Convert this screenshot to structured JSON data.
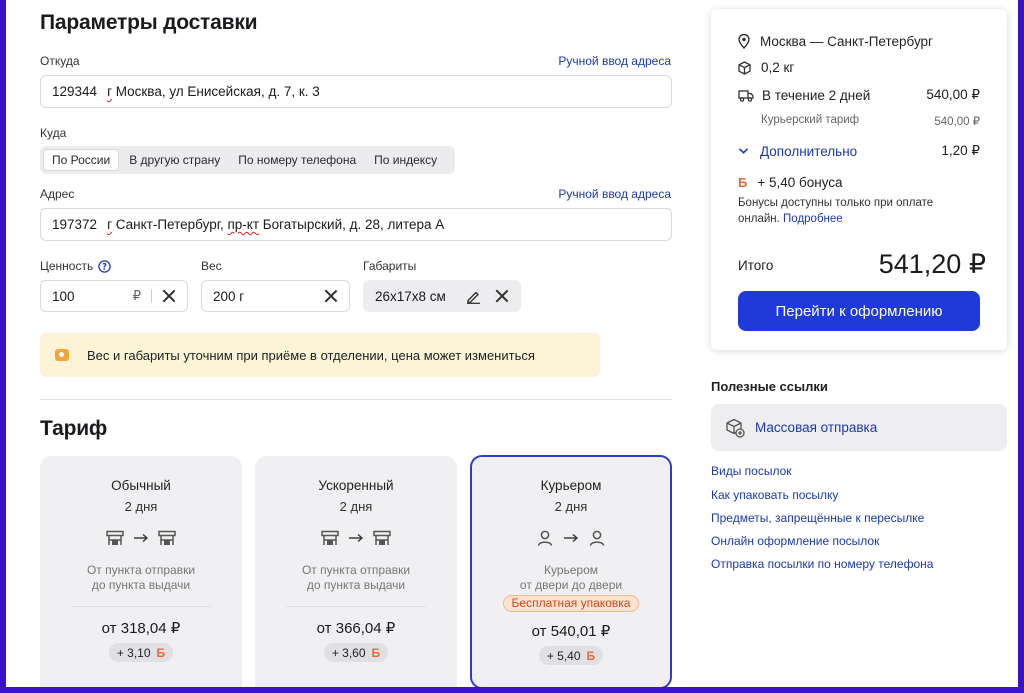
{
  "page": {
    "title": "Параметры доставки",
    "from": {
      "label": "Откуда",
      "manual_link": "Ручной ввод адреса",
      "zip": "129344",
      "w1": "г",
      "address": " Москва, ул Енисейская, ",
      "w2": "д",
      "tail": ". 7, к. 3"
    },
    "to": {
      "label": "Куда",
      "tabs": [
        "По России",
        "В другую страну",
        "По номеру телефона",
        "По индексу"
      ],
      "active_tab": "По России"
    },
    "address": {
      "label": "Адрес",
      "manual_link": "Ручной ввод адреса",
      "zip": "197372",
      "w1": "г",
      "p1": " Санкт-Петербург, ",
      "w2": "пр-кт",
      "p2": " Богатырский, ",
      "w3": "д",
      "p3": ". 28, литера А"
    },
    "value": {
      "label": "Ценность",
      "help_icon": "question-circle-icon",
      "amount": "100",
      "currency": "₽"
    },
    "weight": {
      "label": "Вес",
      "amount": "200 г"
    },
    "dimensions": {
      "label": "Габариты",
      "value": "26x17x8 см",
      "edit_icon": "pencil-icon"
    },
    "notice": "Вес и габариты уточним при приёме в отделении, цена может измениться"
  },
  "tariff": {
    "title": "Тариф",
    "cards": [
      {
        "name": "Обычный",
        "days": "2 дня",
        "route_icons": [
          "post-office-icon",
          "arrow-right-icon",
          "post-office-icon"
        ],
        "desc1": "От пункта отправки",
        "desc2": "до пункта выдачи",
        "price": "от 318,04 ₽",
        "bonus": "+ 3,10",
        "bonus_symbol": "Б",
        "selected": false
      },
      {
        "name": "Ускоренный",
        "days": "2 дня",
        "route_icons": [
          "post-office-icon",
          "arrow-right-icon",
          "post-office-icon"
        ],
        "desc1": "От пункта отправки",
        "desc2": "до пункта выдачи",
        "price": "от 366,04 ₽",
        "bonus": "+ 3,60",
        "bonus_symbol": "Б",
        "selected": false
      },
      {
        "name": "Курьером",
        "days": "2 дня",
        "route_icons": [
          "person-icon",
          "arrow-right-icon",
          "person-icon"
        ],
        "desc1": "Курьером",
        "desc2": "от двери до двери",
        "badge": "Бесплатная упаковка",
        "price": "от 540,01 ₽",
        "bonus": "+ 5,40",
        "bonus_symbol": "Б",
        "selected": true
      }
    ]
  },
  "summary": {
    "route": "Москва — Санкт-Петербург",
    "weight": "0,2 кг",
    "delivery": "В течение 2 дней",
    "delivery_price": "540,00 ₽",
    "tariff_label": "Курьерский тариф",
    "tariff_price": "540,00 ₽",
    "extra_label": "Дополнительно",
    "extra_price": "1,20 ₽",
    "bonus_symbol": "Б",
    "bonus": "+ 5,40 бонуса",
    "bonus_note": "Бонусы доступны только при оплате",
    "bonus_note2": "онлайн.",
    "bonus_more": "Подробнее",
    "total_label": "Итого",
    "total": "541,20 ₽",
    "checkout_button": "Перейти к оформлению"
  },
  "links": {
    "title": "Полезные ссылки",
    "mass_send": "Массовая отправка",
    "items": [
      "Виды посылок",
      "Как упаковать посылку",
      "Предметы, запрещённые к пересылке",
      "Онлайн оформление посылок",
      "Отправка посылки по номеру телефона"
    ]
  },
  "colors": {
    "frame": "#3a12c9",
    "accent": "#1f3ad8",
    "link": "#1b3aa8",
    "selected_border": "#2f3ec7",
    "bonus": "#e36b3a",
    "notice_bg": "#fdf3d7"
  }
}
